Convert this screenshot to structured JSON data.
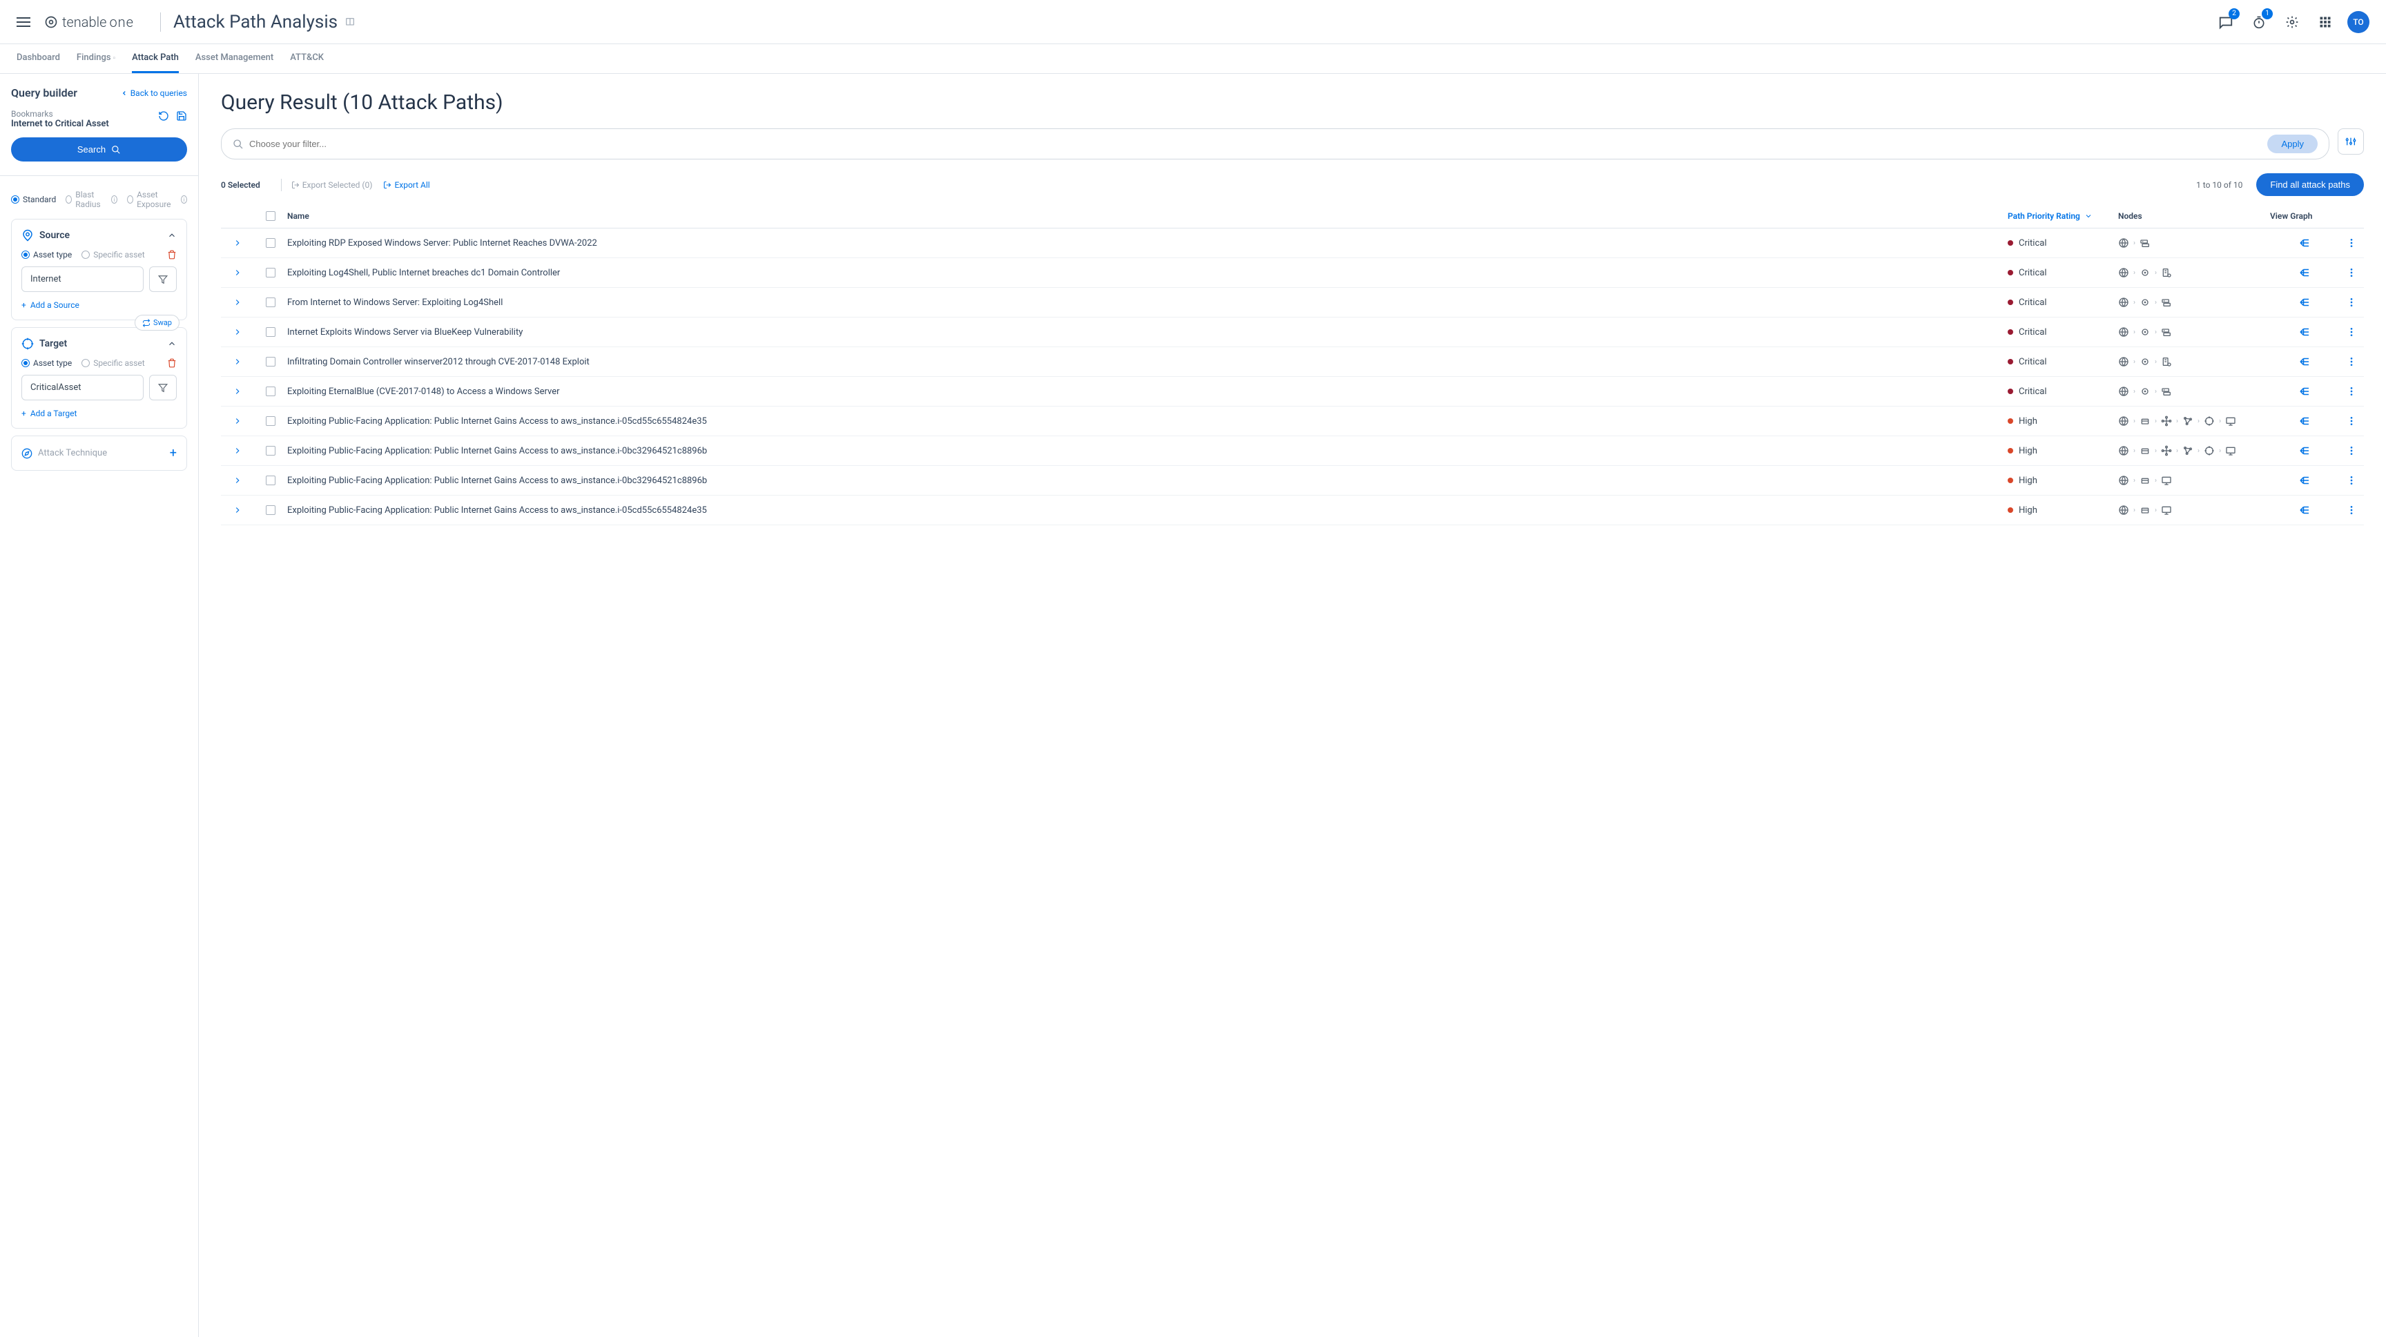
{
  "header": {
    "logo": "tenable",
    "logo_suffix": "one",
    "page_title": "Attack Path Analysis",
    "chat_badge": "2",
    "alert_badge": "1",
    "avatar_initials": "TO"
  },
  "tabs": [
    {
      "label": "Dashboard",
      "active": false
    },
    {
      "label": "Findings",
      "active": false,
      "mini": true
    },
    {
      "label": "Attack Path",
      "active": true
    },
    {
      "label": "Asset Management",
      "active": false
    },
    {
      "label": "ATT&CK",
      "active": false
    }
  ],
  "sidebar": {
    "title": "Query builder",
    "back": "Back to queries",
    "bookmarks_label": "Bookmarks",
    "bookmark_value": "Internet to Critical Asset",
    "search_btn": "Search",
    "mode": [
      {
        "label": "Standard",
        "selected": true
      },
      {
        "label": "Blast Radius",
        "selected": false,
        "info": true
      },
      {
        "label": "Asset Exposure",
        "selected": false,
        "info": true
      }
    ],
    "source": {
      "title": "Source",
      "asset_type_label": "Asset type",
      "specific_label": "Specific asset",
      "value": "Internet",
      "add": "Add a Source"
    },
    "swap": "Swap",
    "target": {
      "title": "Target",
      "asset_type_label": "Asset type",
      "specific_label": "Specific asset",
      "value": "CriticalAsset",
      "add": "Add a Target"
    },
    "attack_technique": "Attack Technique"
  },
  "main": {
    "title": "Query Result (10 Attack Paths)",
    "filter_placeholder": "Choose your filter...",
    "apply": "Apply",
    "selected": "0 Selected",
    "export_selected": "Export Selected (0)",
    "export_all": "Export All",
    "paging": "1 to 10 of 10",
    "find_all": "Find all attack paths",
    "columns": {
      "name": "Name",
      "priority": "Path Priority Rating",
      "nodes": "Nodes",
      "graph": "View Graph"
    },
    "rows": [
      {
        "name": "Exploiting RDP Exposed Windows Server: Public Internet Reaches DVWA-2022",
        "priority": "Critical",
        "nodes": [
          "globe",
          "server"
        ]
      },
      {
        "name": "Exploiting Log4Shell, Public Internet breaches dc1 Domain Controller",
        "priority": "Critical",
        "nodes": [
          "globe",
          "circle",
          "dc"
        ]
      },
      {
        "name": "From Internet to Windows Server: Exploiting Log4Shell",
        "priority": "Critical",
        "nodes": [
          "globe",
          "circle",
          "server"
        ]
      },
      {
        "name": "Internet Exploits Windows Server via BlueKeep Vulnerability",
        "priority": "Critical",
        "nodes": [
          "globe",
          "circle",
          "server"
        ]
      },
      {
        "name": "Infiltrating Domain Controller winserver2012 through CVE-2017-0148 Exploit",
        "priority": "Critical",
        "nodes": [
          "globe",
          "circle",
          "dc"
        ]
      },
      {
        "name": "Exploiting EternalBlue (CVE-2017-0148) to Access a Windows Server",
        "priority": "Critical",
        "nodes": [
          "globe",
          "circle",
          "server"
        ]
      },
      {
        "name": "Exploiting Public-Facing Application: Public Internet Gains Access to aws_instance.i-05cd55c6554824e35",
        "priority": "High",
        "nodes": [
          "globe",
          "box",
          "branch",
          "scatter",
          "target",
          "monitor"
        ]
      },
      {
        "name": "Exploiting Public-Facing Application: Public Internet Gains Access to aws_instance.i-0bc32964521c8896b",
        "priority": "High",
        "nodes": [
          "globe",
          "box",
          "branch",
          "scatter",
          "target",
          "monitor"
        ]
      },
      {
        "name": "Exploiting Public-Facing Application: Public Internet Gains Access to aws_instance.i-0bc32964521c8896b",
        "priority": "High",
        "nodes": [
          "globe",
          "box",
          "monitor"
        ]
      },
      {
        "name": "Exploiting Public-Facing Application: Public Internet Gains Access to aws_instance.i-05cd55c6554824e35",
        "priority": "High",
        "nodes": [
          "globe",
          "box",
          "monitor"
        ]
      }
    ]
  }
}
